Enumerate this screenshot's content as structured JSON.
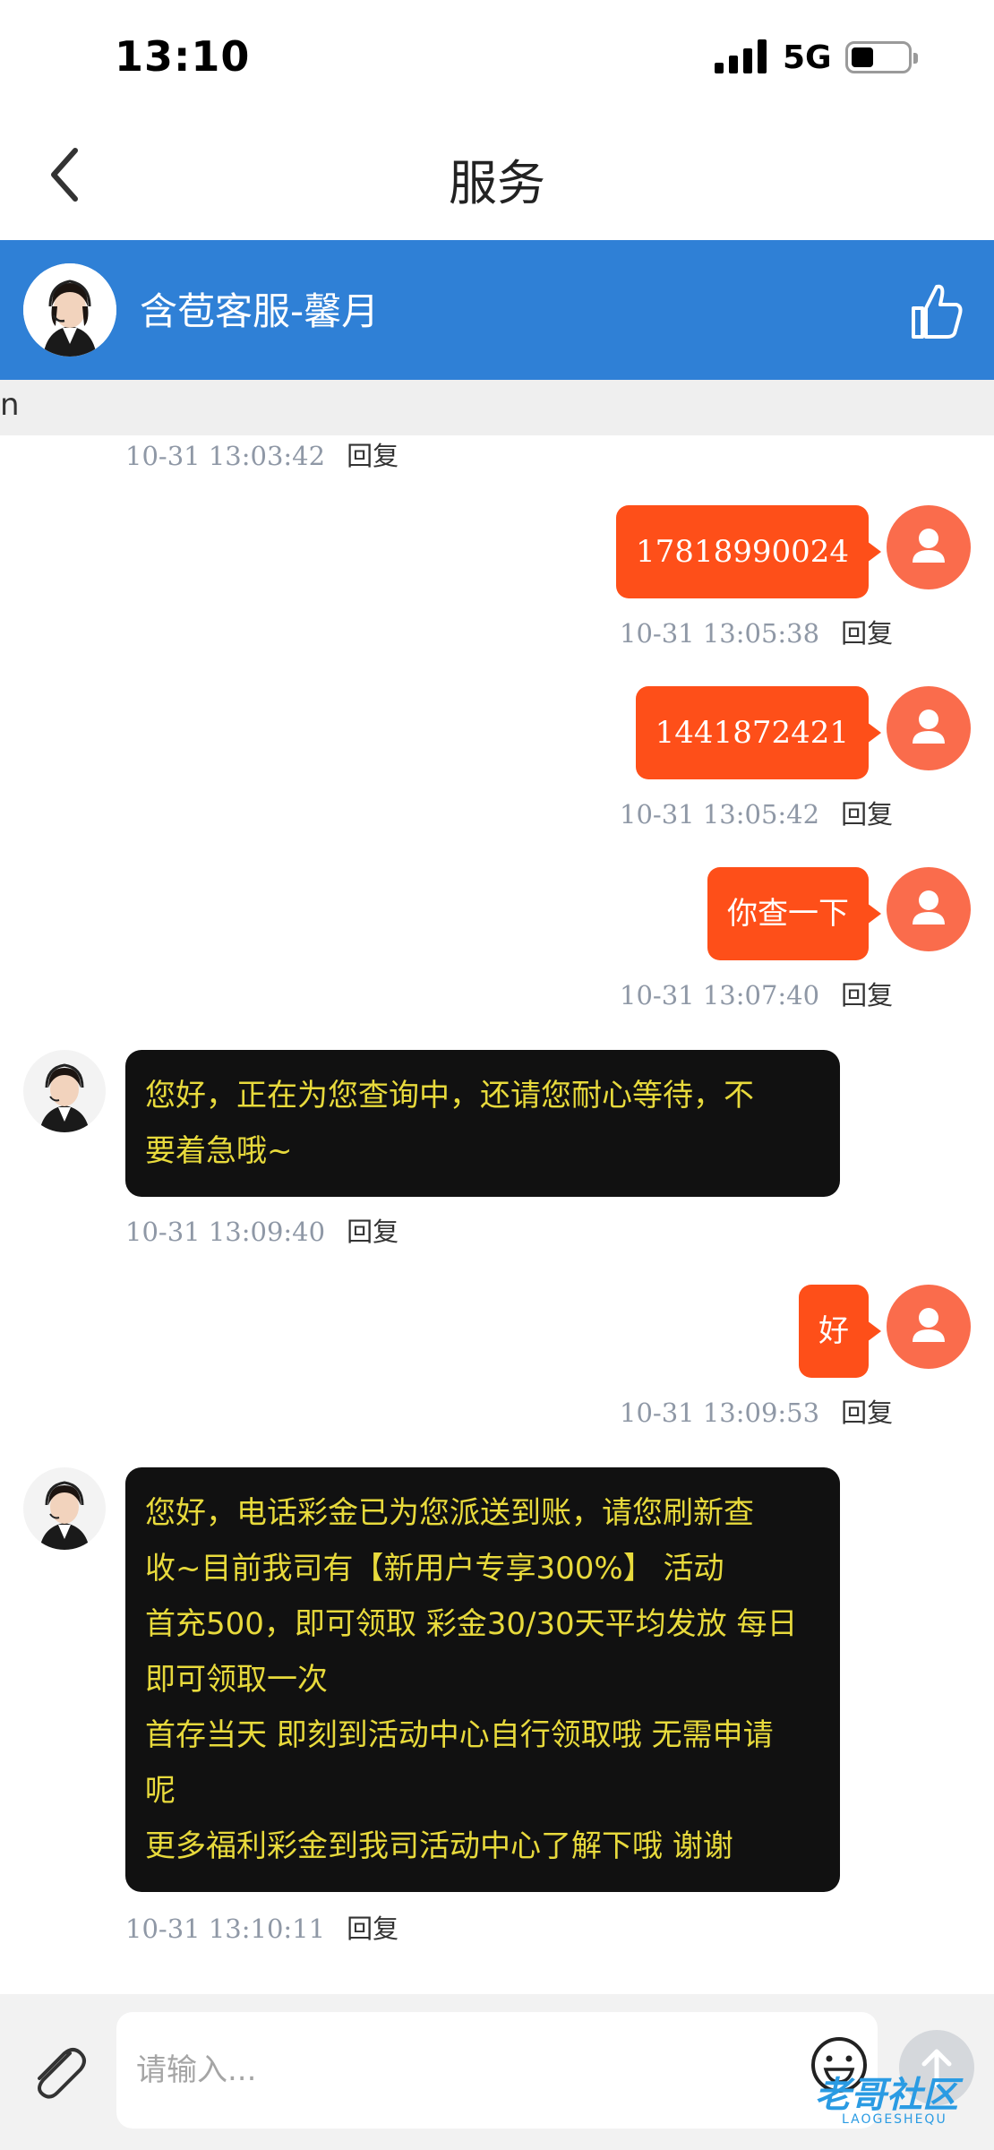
{
  "status_bar": {
    "time": "13:10",
    "network": "5G"
  },
  "nav": {
    "title": "服务"
  },
  "agent": {
    "name": "含苞客服-馨月"
  },
  "notice": {
    "text": "n"
  },
  "messages": [
    {
      "from": "agent",
      "time": "10-31 13:03:42",
      "reply": "回复"
    },
    {
      "from": "user",
      "text": "17818990024",
      "time": "10-31 13:05:38",
      "reply": "回复"
    },
    {
      "from": "user",
      "text": "1441872421",
      "time": "10-31 13:05:42",
      "reply": "回复"
    },
    {
      "from": "user",
      "text": "你查一下",
      "time": "10-31 13:07:40",
      "reply": "回复"
    },
    {
      "from": "agent",
      "lines": [
        "您好，正在为您查询中，还请您耐心等待，不",
        "要着急哦~"
      ],
      "time": "10-31 13:09:40",
      "reply": "回复"
    },
    {
      "from": "user",
      "text": "好",
      "time": "10-31 13:09:53",
      "reply": "回复"
    },
    {
      "from": "agent",
      "lines": [
        "您好，电话彩金已为您派送到账，请您刷新查",
        "收~目前我司有【新用户专享300%】 活动",
        "首充500，即可领取 彩金30/30天平均发放 每日",
        "即可领取一次",
        "首存当天 即刻到活动中心自行领取哦 无需申请",
        "呢",
        "更多福利彩金到我司活动中心了解下哦 谢谢"
      ],
      "time": "10-31 13:10:11",
      "reply": "回复"
    }
  ],
  "input": {
    "placeholder": "请输入..."
  },
  "watermark": {
    "text": "老哥社区",
    "sub": "LAOGESHEQU"
  },
  "colors": {
    "header_blue": "#2f80d6",
    "user_bubble": "#fe4f19",
    "agent_bubble": "#111111",
    "agent_text": "#e8da3c"
  },
  "icons": [
    "back-icon",
    "thumb-up-icon",
    "user-avatar-icon",
    "paperclip-icon",
    "emoji-icon",
    "send-arrow-icon"
  ]
}
